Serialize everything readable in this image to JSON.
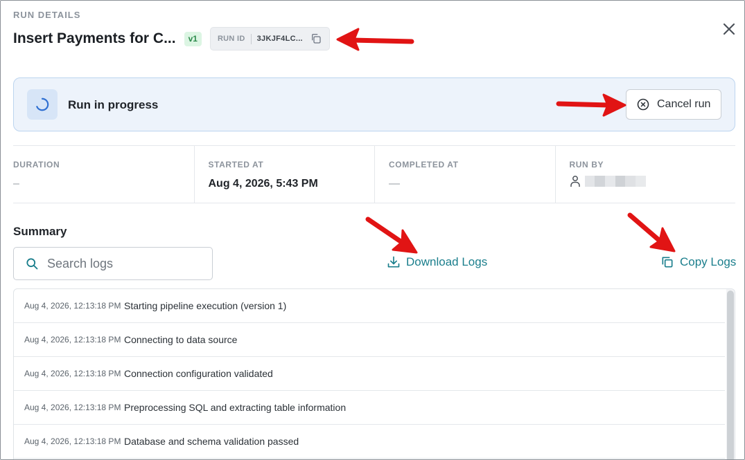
{
  "header": {
    "section_label": "RUN DETAILS",
    "title": "Insert Payments for C...",
    "version": "v1",
    "run_id_label": "RUN ID",
    "run_id_value": "3JKJF4LC..."
  },
  "banner": {
    "status_text": "Run in progress",
    "cancel_label": "Cancel run"
  },
  "stats": {
    "duration": {
      "label": "DURATION",
      "value": "–"
    },
    "started_at": {
      "label": "STARTED AT",
      "value": "Aug 4, 2026, 5:43 PM"
    },
    "completed_at": {
      "label": "COMPLETED AT",
      "value": "—"
    },
    "run_by": {
      "label": "RUN BY"
    }
  },
  "summary": {
    "title": "Summary",
    "search_placeholder": "Search logs",
    "download_label": "Download Logs",
    "copy_label": "Copy Logs"
  },
  "logs": [
    {
      "time": "Aug 4, 2026, 12:13:18 PM",
      "message": "Starting pipeline execution (version 1)"
    },
    {
      "time": "Aug 4, 2026, 12:13:18 PM",
      "message": "Connecting to data source"
    },
    {
      "time": "Aug 4, 2026, 12:13:18 PM",
      "message": "Connection configuration validated"
    },
    {
      "time": "Aug 4, 2026, 12:13:18 PM",
      "message": "Preprocessing SQL and extracting table information"
    },
    {
      "time": "Aug 4, 2026, 12:13:18 PM",
      "message": "Database and schema validation passed"
    }
  ],
  "colors": {
    "accent_teal": "#1a7e8c",
    "banner_bg": "#edf3fb",
    "banner_border": "#bcd4ef",
    "annotation_red": "#e11414",
    "version_badge_bg": "#dcf5e3",
    "version_badge_fg": "#2c8a4b"
  },
  "icons": {
    "copy_run_id": "copy-icon",
    "close": "close-icon",
    "status": "spinner-icon",
    "cancel": "circle-x-icon",
    "run_by": "user-icon",
    "search": "search-icon",
    "download": "download-icon",
    "copy_logs": "copy-icon"
  }
}
